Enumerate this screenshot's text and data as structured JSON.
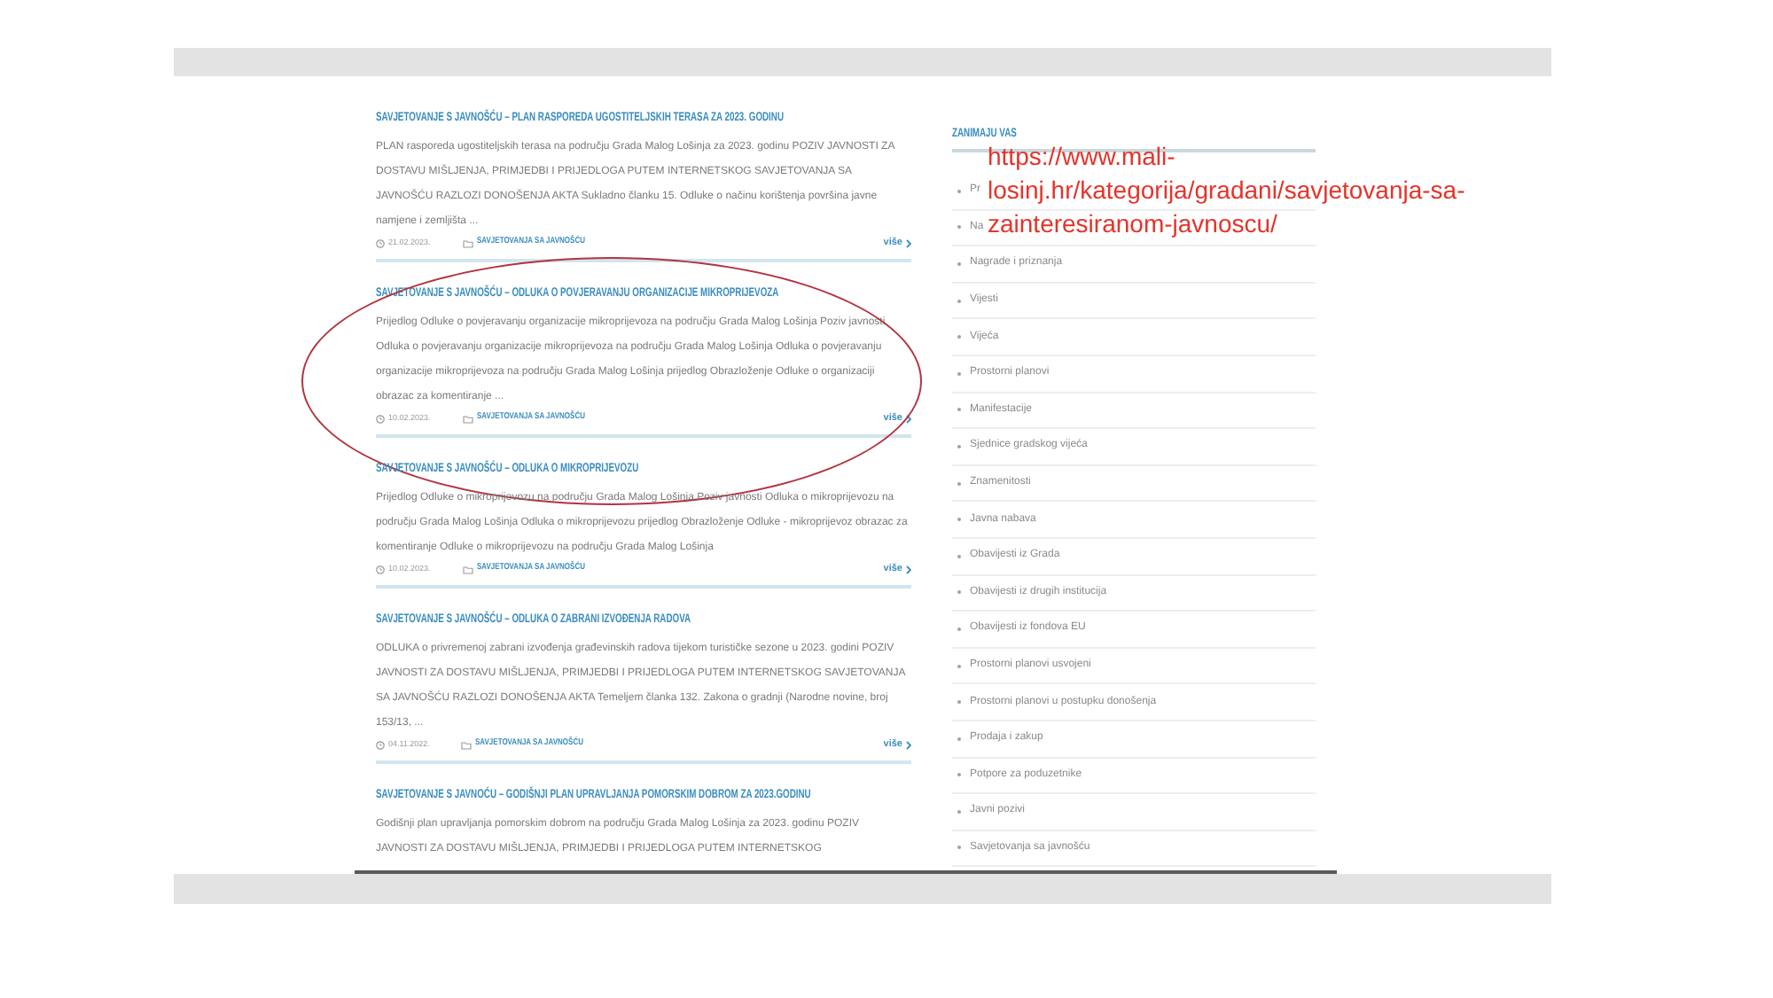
{
  "articles": [
    {
      "title": "SAVJETOVANJE S JAVNOŠĆU – PLAN RASPOREDA UGOSTITELJSKIH TERASA ZA 2023. GODINU",
      "excerpt": "PLAN rasporeda ugostiteljskih terasa na području Grada Malog Lošinja za 2023. godinu POZIV JAVNOSTI ZA DOSTAVU MIŠLJENJA, PRIMJEDBI I PRIJEDLOGA PUTEM INTERNETSKOG SAVJETOVANJA SA JAVNOŠĆU RAZLOZI DONOŠENJA AKTA Sukladno članku 15. Odluke o načinu korištenja površina javne namjene i zemljišta ...",
      "date": "21.02.2023.",
      "category": "SAVJETOVANJA SA JAVNOŠĆU",
      "more": "više",
      "highlighted": false
    },
    {
      "title": "SAVJETOVANJE S JAVNOŠĆU – ODLUKA O POVJERAVANJU ORGANIZACIJE MIKROPRIJEVOZA",
      "excerpt": "Prijedlog Odluke o povjeravanju organizacije mikroprijevoza na području Grada Malog Lošinja Poziv javnosti Odluka o povjeravanju organizacije mikroprijevoza na području Grada Malog Lošinja Odluka o povjeravanju organizacije mikroprijevoza na području Grada Malog Lošinja prijedlog Obrazloženje Odluke o organizaciji obrazac za komentiranje ...",
      "date": "10.02.2023.",
      "category": "SAVJETOVANJA SA JAVNOŠĆU",
      "more": "više",
      "highlighted": true
    },
    {
      "title": "SAVJETOVANJE S JAVNOŠĆU – ODLUKA O MIKROPRIJEVOZU",
      "excerpt": "Prijedlog Odluke o mikroprijevozu na području Grada Malog Lošinja Poziv javnosti Odluka o mikroprijevozu na području Grada Malog Lošinja Odluka o mikroprijevozu prijedlog Obrazloženje Odluke - mikroprijevoz obrazac za komentiranje Odluke o mikroprijevozu na području Grada Malog Lošinja",
      "date": "10.02.2023.",
      "category": "SAVJETOVANJA SA JAVNOŠĆU",
      "more": "više",
      "highlighted": false
    },
    {
      "title": "SAVJETOVANJE S JAVNOŠĆU – ODLUKA O ZABRANI IZVOĐENJA RADOVA",
      "excerpt": "ODLUKA o privremenoj zabrani izvođenja građevinskih radova tijekom turističke sezone u 2023. godini POZIV JAVNOSTI ZA DOSTAVU MIŠLJENJA, PRIMJEDBI I PRIJEDLOGA PUTEM INTERNETSKOG SAVJETOVANJA SA JAVNOŠĆU RAZLOZI DONOŠENJA AKTA Temeljem članka 132. Zakona o gradnji (Narodne novine, broj 153/13, ...",
      "date": "04.11.2022.",
      "category": "SAVJETOVANJA SA JAVNOŠĆU",
      "more": "više",
      "highlighted": false
    },
    {
      "title": "SAVJETOVANJE S JAVNOĆU – GODIŠNJI PLAN UPRAVLJANJA POMORSKIM DOBROM ZA 2023.GODINU",
      "excerpt": "Godišnji plan upravljanja pomorskim dobrom na području Grada Malog Lošinja za 2023. godinu POZIV JAVNOSTI ZA DOSTAVU MIŠLJENJA, PRIMJEDBI I PRIJEDLOGA PUTEM INTERNETSKOG",
      "highlighted": false
    }
  ],
  "sidebar": {
    "heading": "ZANIMAJU VAS",
    "items": [
      "Pr",
      "Na",
      "Nagrade i priznanja",
      "Vijesti",
      "Vijeća",
      "Prostorni planovi",
      "Manifestacije",
      "Sjednice gradskog vijeća",
      "Znamenitosti",
      "Javna nabava",
      "Obavijesti iz Grada",
      "Obavijesti iz drugih institucija",
      "Obavijesti iz fondova EU",
      "Prostorni planovi usvojeni",
      "Prostorni planovi u postupku donošenja",
      "Prodaja i zakup",
      "Potpore za poduzetnike",
      "Javni pozivi",
      "Savjetovanja sa javnošću"
    ]
  },
  "url_annotation": "https://www.mali-losinj.hr/kategorija/gradani/savjetovanja-sa-zainteresiranom-javnoscu/"
}
